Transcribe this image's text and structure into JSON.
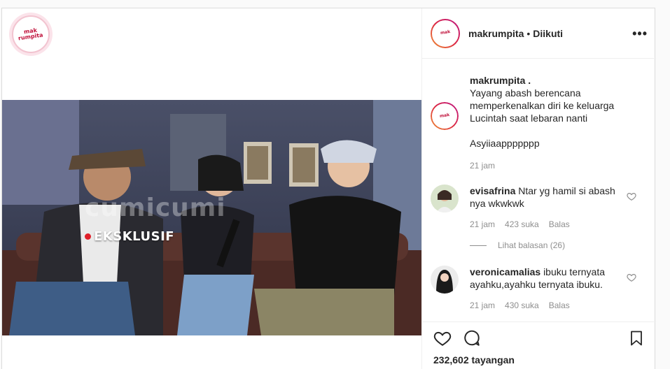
{
  "media": {
    "logo_text_top": "mak",
    "logo_text_bottom": "rumpita",
    "video": {
      "watermark": "cumicumi",
      "badge": "EKSKLUSIF"
    }
  },
  "header": {
    "username": "makrumpita",
    "separator": "•",
    "follow_status": "Diikuti",
    "more": "•••"
  },
  "caption": {
    "username": "makrumpita .",
    "lines": [
      "Yayang abash berencana",
      "memperkenalkan diri ke keluarga",
      "Lucintah saat lebaran nanti"
    ],
    "extra": "Asyiiaappppppp",
    "time": "21 jam"
  },
  "comments": [
    {
      "username": "evisafrina",
      "text": "Ntar yg hamil si abash nya wkwkwk",
      "time": "21 jam",
      "likes": "423 suka",
      "reply": "Balas"
    },
    {
      "username": "veronicamalias",
      "text": "ibuku ternyata ayahku,ayahku ternyata ibuku.",
      "time": "21 jam",
      "likes": "430 suka",
      "reply": "Balas"
    }
  ],
  "view_replies": "Lihat balasan (26)",
  "views": "232,602 tayangan",
  "icons": {
    "like": "heart-icon",
    "comment": "comment-icon",
    "save": "bookmark-icon",
    "more": "more-icon"
  },
  "colors": {
    "brand_red": "#c0103a",
    "text": "#262626",
    "muted": "#8e8e8e",
    "border": "#dbdbdb"
  }
}
